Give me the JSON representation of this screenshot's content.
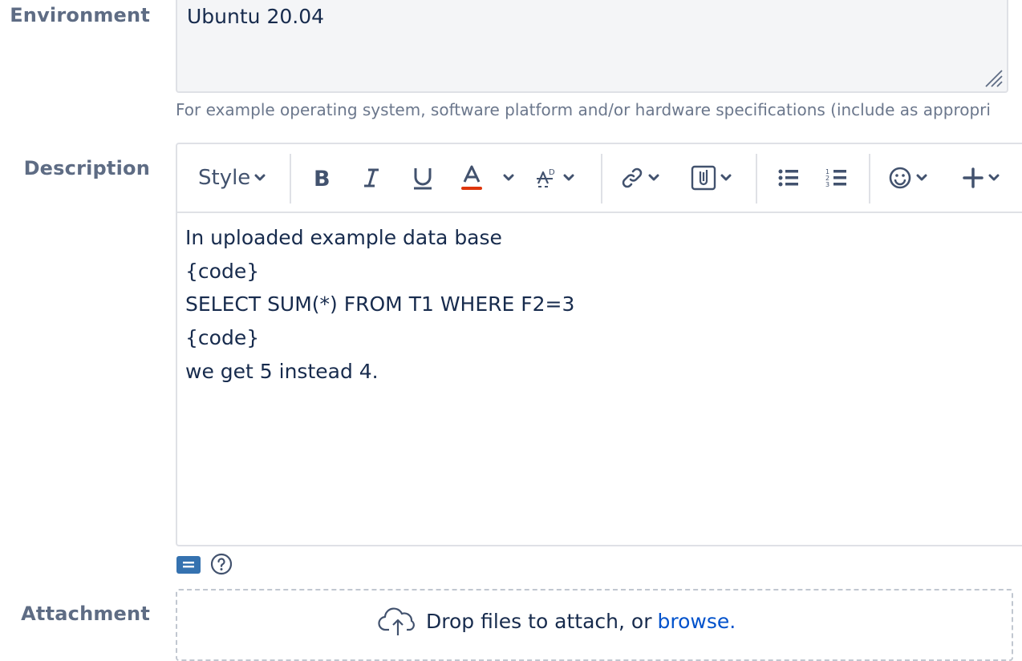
{
  "environment": {
    "label": "Environment",
    "value": "Ubuntu 20.04",
    "help": "For example operating system, software platform and/or hardware specifications (include as appropri"
  },
  "description": {
    "label": "Description",
    "toolbar": {
      "style_label": "Style"
    },
    "lines": [
      "In uploaded example data base",
      "{code}",
      "SELECT SUM(*) FROM T1 WHERE F2=3",
      "{code}",
      "we get 5 instead 4."
    ]
  },
  "attachment": {
    "label": "Attachment",
    "drop_text": "Drop files to attach, or",
    "browse_text": "browse."
  },
  "colors": {
    "text_color_underline": "#de350b",
    "mode_button": "#3572b0",
    "link": "#0052cc"
  }
}
